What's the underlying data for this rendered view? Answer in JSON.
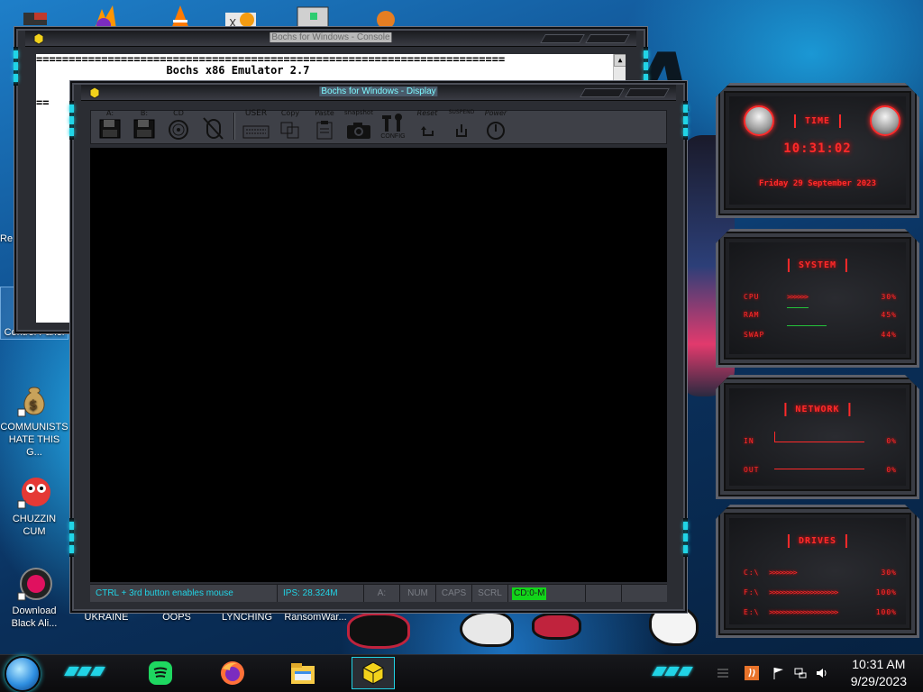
{
  "desktop": {
    "icons": [
      {
        "label": "Control Panel"
      },
      {
        "label": "COMMUNISTS HATE THIS G..."
      },
      {
        "label": "CHUZZIN CUM"
      },
      {
        "label": "Download Black Ali..."
      }
    ],
    "partial_labels": {
      "recycle": "Re",
      "ukraine": "UKRAINE",
      "oops": "OOPS",
      "lynching": "LYNCHING",
      "ransom": "RansomWar..."
    }
  },
  "console_window": {
    "title": "Bochs for Windows - Console",
    "lines": [
      "========================================================================",
      "                    Bochs x86 Emulator 2.7",
      "=="
    ],
    "scroll_up": "▲"
  },
  "display_window": {
    "title": "Bochs for Windows - Display",
    "toolbar": {
      "floppy_a": "A:",
      "floppy_b": "B:",
      "cdrom": "CD",
      "user": "USER",
      "copy": "Copy",
      "paste": "Paste",
      "snapshot": "snapshot",
      "config": "CONFIG",
      "reset": "Reset",
      "suspend": "SUSPEND",
      "power": "Power"
    },
    "status": {
      "mouse_hint": "CTRL + 3rd button enables mouse",
      "ips": "IPS: 28.324M",
      "drive": "A:",
      "num": "NUM",
      "caps": "CAPS",
      "scrl": "SCRL",
      "cd": "CD:0-M"
    }
  },
  "gadgets": {
    "time": {
      "title": "TIME",
      "clock": "10:31:02",
      "date": "Friday 29 September 2023"
    },
    "system": {
      "title": "SYSTEM",
      "rows": [
        {
          "label": "CPU",
          "value": "30%"
        },
        {
          "label": "RAM",
          "value": "45%"
        },
        {
          "label": "SWAP",
          "value": "44%"
        }
      ]
    },
    "network": {
      "title": "NETWORK",
      "rows": [
        {
          "label": "IN",
          "value": "0%"
        },
        {
          "label": "OUT",
          "value": "0%"
        }
      ]
    },
    "drives": {
      "title": "DRIVES",
      "rows": [
        {
          "label": "C:\\",
          "value": "30%"
        },
        {
          "label": "F:\\",
          "value": "100%"
        },
        {
          "label": "E:\\",
          "value": "100%"
        }
      ]
    }
  },
  "taskbar": {
    "apps": [
      "spotify-icon",
      "firefox-icon",
      "file-explorer-icon",
      "bochs-icon"
    ],
    "tray": {
      "time": "10:31 AM",
      "date": "9/29/2023"
    }
  },
  "colors": {
    "accent_cyan": "#21d4e6",
    "gadget_red": "#ff2a2a",
    "frame": "#2b2d33",
    "cd_green": "#12d41a"
  }
}
